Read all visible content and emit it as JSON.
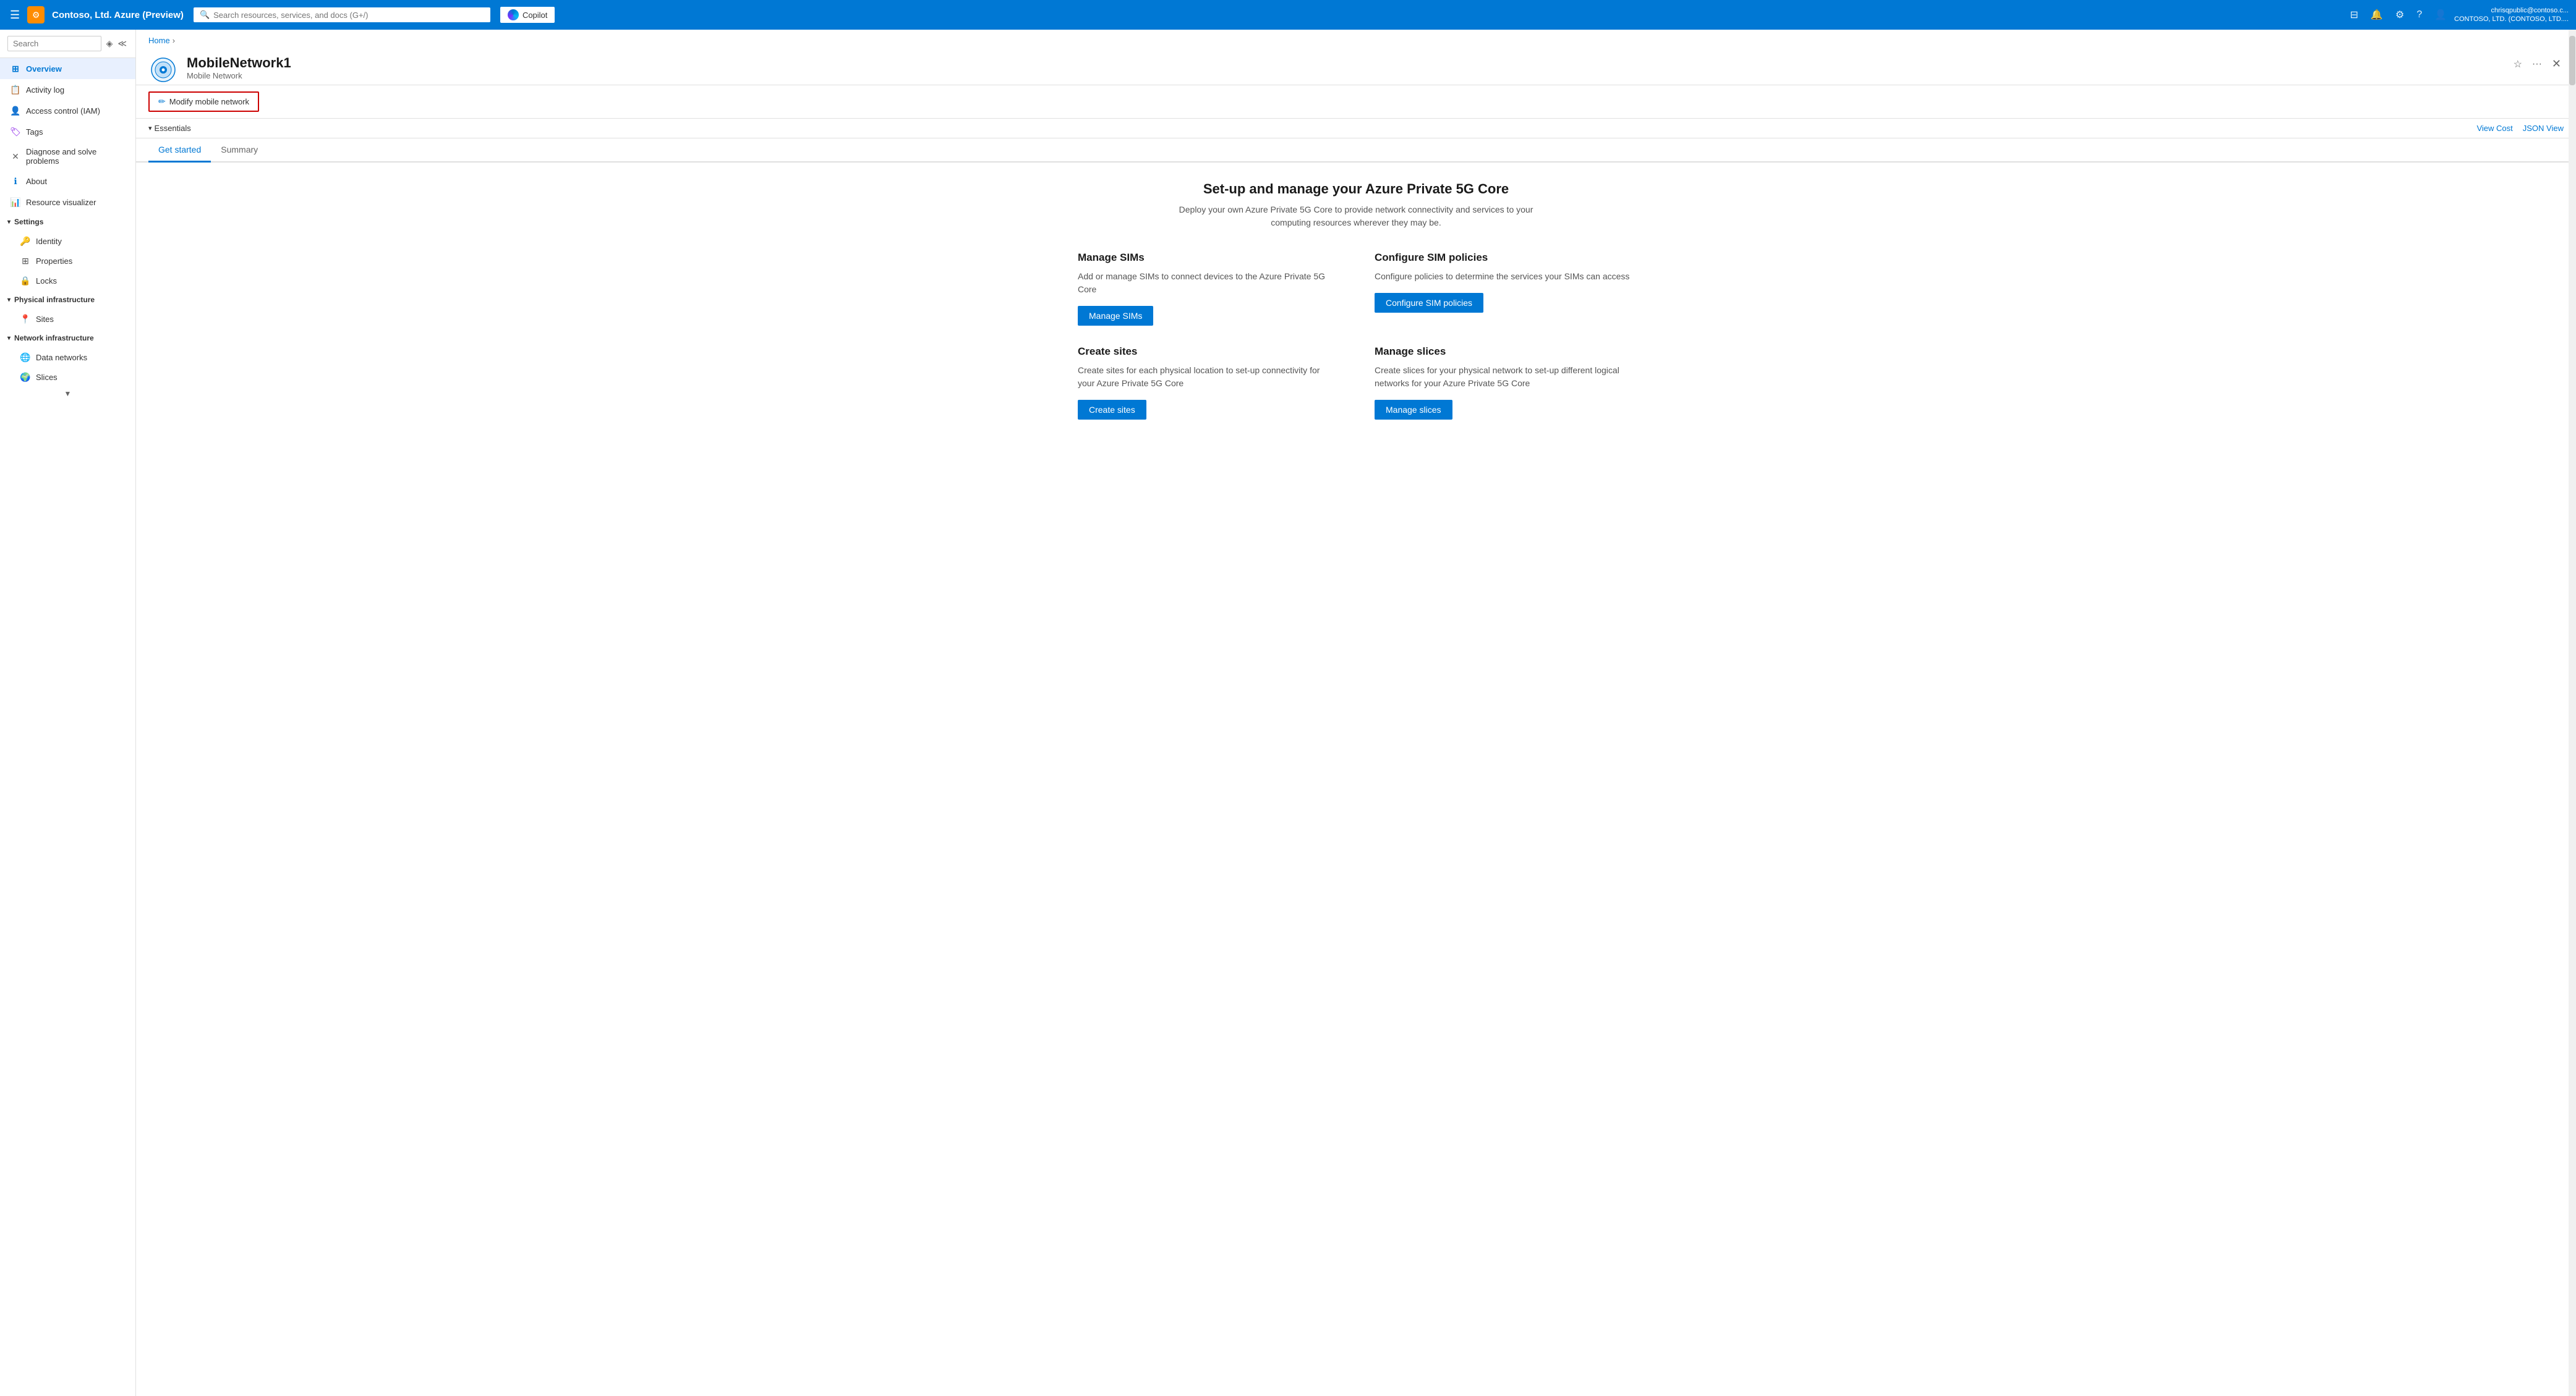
{
  "topnav": {
    "hamburger_label": "☰",
    "title": "Contoso, Ltd. Azure (Preview)",
    "icon_symbol": "⚙",
    "search_placeholder": "Search resources, services, and docs (G+/)",
    "copilot_label": "Copilot",
    "actions": [
      "⊟",
      "🔔",
      "⚙",
      "?",
      "👤"
    ],
    "user_name": "chrisqpublic@contoso.c...",
    "user_org": "CONTOSO, LTD. (CONTOSO, LTD...."
  },
  "breadcrumb": {
    "home_label": "Home",
    "separator": "›"
  },
  "resource": {
    "name": "MobileNetwork1",
    "type": "Mobile Network",
    "fav_icon": "☆",
    "menu_icon": "···",
    "close_icon": "✕"
  },
  "sidebar": {
    "search_placeholder": "Search",
    "items": [
      {
        "id": "overview",
        "label": "Overview",
        "icon": "⬛",
        "active": true
      },
      {
        "id": "activity-log",
        "label": "Activity log",
        "icon": "📋"
      },
      {
        "id": "access-control",
        "label": "Access control (IAM)",
        "icon": "👤"
      },
      {
        "id": "tags",
        "label": "Tags",
        "icon": "🏷"
      },
      {
        "id": "diagnose",
        "label": "Diagnose and solve problems",
        "icon": "🔧"
      },
      {
        "id": "about",
        "label": "About",
        "icon": "ℹ"
      },
      {
        "id": "resource-visualizer",
        "label": "Resource visualizer",
        "icon": "📊"
      }
    ],
    "settings_section": "Settings",
    "settings_items": [
      {
        "id": "identity",
        "label": "Identity",
        "icon": "🔑"
      },
      {
        "id": "properties",
        "label": "Properties",
        "icon": "⊞"
      },
      {
        "id": "locks",
        "label": "Locks",
        "icon": "🔒"
      }
    ],
    "physical_section": "Physical infrastructure",
    "physical_items": [
      {
        "id": "sites",
        "label": "Sites",
        "icon": "📍"
      }
    ],
    "network_section": "Network infrastructure",
    "network_items": [
      {
        "id": "data-networks",
        "label": "Data networks",
        "icon": "🌐"
      },
      {
        "id": "slices",
        "label": "Slices",
        "icon": "🌍"
      }
    ]
  },
  "toolbar": {
    "modify_label": "Modify mobile network",
    "edit_icon": "✏"
  },
  "essentials": {
    "label": "Essentials",
    "view_cost": "View Cost",
    "json_view": "JSON View"
  },
  "tabs": [
    {
      "id": "get-started",
      "label": "Get started",
      "active": true
    },
    {
      "id": "summary",
      "label": "Summary",
      "active": false
    }
  ],
  "main": {
    "hero_title": "Set-up and manage your Azure Private 5G Core",
    "hero_subtitle": "Deploy your own Azure Private 5G Core to provide network connectivity and services to your computing resources wherever they may be.",
    "cards": [
      {
        "id": "manage-sims",
        "title": "Manage SIMs",
        "description": "Add or manage SIMs to connect devices to the Azure Private 5G Core",
        "button_label": "Manage SIMs"
      },
      {
        "id": "configure-sim-policies",
        "title": "Configure SIM policies",
        "description": "Configure policies to determine the services your SIMs can access",
        "button_label": "Configure SIM policies"
      },
      {
        "id": "create-sites",
        "title": "Create sites",
        "description": "Create sites for each physical location to set-up connectivity for your Azure Private 5G Core",
        "button_label": "Create sites"
      },
      {
        "id": "manage-slices",
        "title": "Manage slices",
        "description": "Create slices for your physical network to set-up different logical networks for your Azure Private 5G Core",
        "button_label": "Manage slices"
      }
    ]
  }
}
